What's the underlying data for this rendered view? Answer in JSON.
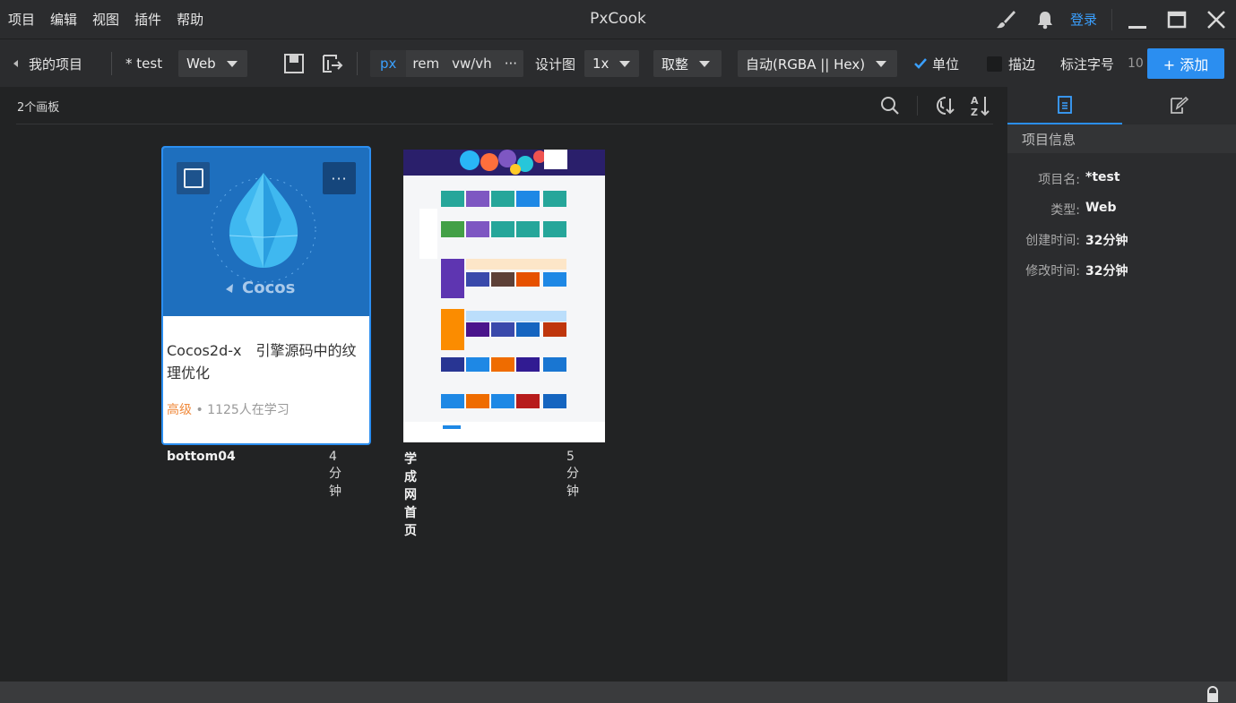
{
  "menu": [
    "项目",
    "编辑",
    "视图",
    "插件",
    "帮助"
  ],
  "app_title": "PxCook",
  "titlebar": {
    "login": "登录",
    "icons": [
      "brush-icon",
      "bell-icon",
      "minimize-icon",
      "maximize-icon",
      "close-icon"
    ]
  },
  "toolbar": {
    "back_label": "我的项目",
    "project_name": "* test",
    "platform": "Web",
    "units": [
      "px",
      "rem",
      "vw/vh",
      "···"
    ],
    "active_unit": "px",
    "design_label": "设计图",
    "design_scale": "1x",
    "rounding": "取整",
    "color_format": "自动(RGBA || Hex)",
    "unit_check_label": "单位",
    "unit_checked": true,
    "stroke_label": "描边",
    "stroke_checked": false,
    "font_size_label": "标注字号",
    "font_size_value": "10",
    "add_label": "+ 添加",
    "accent": "#2b8ef0"
  },
  "main": {
    "board_count": "2个画板",
    "boards": [
      {
        "name": "bottom04",
        "time": "4分钟",
        "selected": true,
        "preview": {
          "brand": "Cocos",
          "title": "Cocos2d-x　引擎源码中的纹理优化",
          "level": "高级",
          "learners": "1125人在学习"
        }
      },
      {
        "name": "学成网首页",
        "time": "5分钟",
        "selected": false
      }
    ]
  },
  "panel": {
    "section_title": "项目信息",
    "rows": [
      {
        "key": "项目名:",
        "value": "*test"
      },
      {
        "key": "类型:",
        "value": "Web"
      },
      {
        "key": "创建时间:",
        "value": "32分钟"
      },
      {
        "key": "修改时间:",
        "value": "32分钟"
      }
    ]
  }
}
